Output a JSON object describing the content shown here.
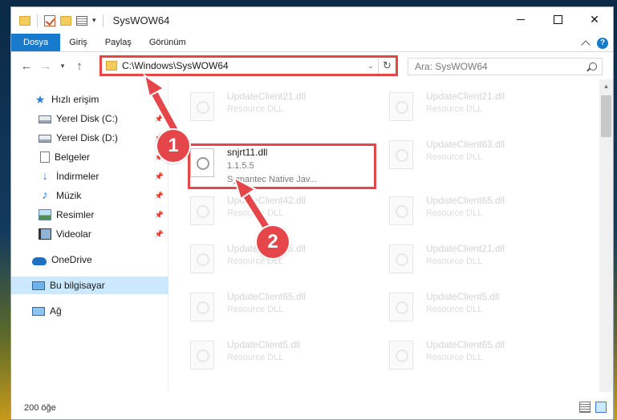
{
  "window": {
    "title": "SysWOW64"
  },
  "ribbon": {
    "tabs": [
      "Dosya",
      "Giriş",
      "Paylaş",
      "Görünüm"
    ],
    "help": "?"
  },
  "window_controls": {
    "close": "✕"
  },
  "nav": {
    "back": "←",
    "forward": "→",
    "recent": "▾",
    "up": "↑"
  },
  "address": {
    "path": "C:\\Windows\\SysWOW64",
    "dropdown": "⌄",
    "refresh": "↻"
  },
  "search": {
    "placeholder": "Ara: SysWOW64"
  },
  "sidebar": {
    "items": [
      {
        "label": "Hızlı erişim",
        "icon": "star-icon"
      },
      {
        "label": "Yerel Disk (C:)",
        "icon": "drive-icon",
        "pinned": true
      },
      {
        "label": "Yerel Disk (D:)",
        "icon": "drive-icon",
        "pinned": true
      },
      {
        "label": "Belgeler",
        "icon": "document-icon",
        "pinned": true
      },
      {
        "label": "İndirmeler",
        "icon": "download-icon",
        "pinned": true
      },
      {
        "label": "Müzik",
        "icon": "music-icon",
        "pinned": true
      },
      {
        "label": "Resimler",
        "icon": "pictures-icon",
        "pinned": true
      },
      {
        "label": "Videolar",
        "icon": "video-icon",
        "pinned": true
      },
      {
        "label": "OneDrive",
        "icon": "cloud-icon"
      },
      {
        "label": "Bu bilgisayar",
        "icon": "computer-icon",
        "selected": true
      },
      {
        "label": "Ağ",
        "icon": "network-icon"
      }
    ],
    "pin_glyph": "📌"
  },
  "files": {
    "col1": [
      {
        "name": "UpdateClient21.dll",
        "desc": "Resource DLL"
      },
      {
        "name": "snjrt11.dll",
        "version": "1.1.5.5",
        "desc": "Symantec Native Jav...",
        "selected": true
      },
      {
        "name": "UpdateClient42.dll",
        "desc": "Resource DLL"
      },
      {
        "name": "UpdateClient65.dll",
        "desc": "Resource DLL"
      },
      {
        "name": "UpdateClient65.dll",
        "desc": "Resource DLL"
      },
      {
        "name": "UpdateClient5.dll",
        "desc": "Resource DLL"
      }
    ],
    "col2": [
      {
        "name": "UpdateClient21.dll",
        "desc": "Resource DLL"
      },
      {
        "name": "UpdateClient63.dll",
        "desc": "Resource DLL"
      },
      {
        "name": "UpdateClient65.dll",
        "desc": "Resource DLL"
      },
      {
        "name": "UpdateClient21.dll",
        "desc": "Resource DLL"
      },
      {
        "name": "UpdateClient5.dll",
        "desc": "Resource DLL"
      },
      {
        "name": "UpdateClient65.dll",
        "desc": "Resource DLL"
      }
    ]
  },
  "status": {
    "count": "200 öğe"
  },
  "annotations": {
    "step1": "1",
    "step2": "2",
    "color": "#e4464a"
  }
}
